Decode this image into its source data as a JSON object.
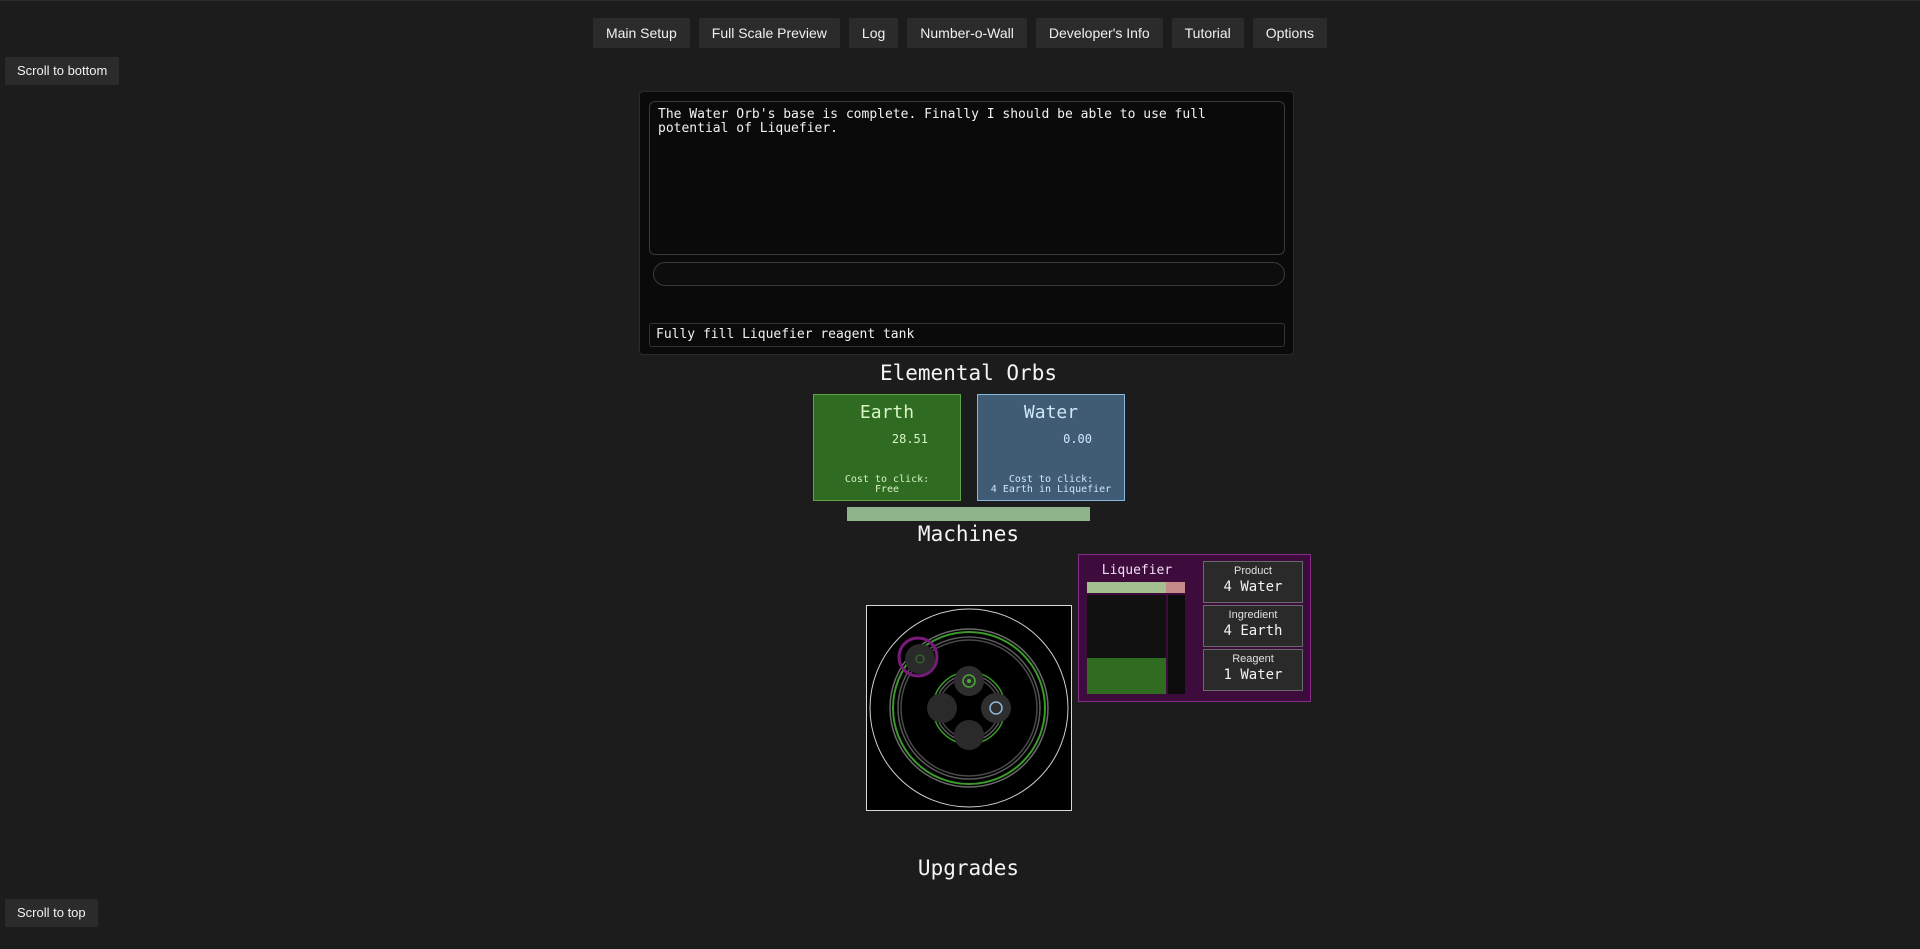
{
  "nav": {
    "items": [
      {
        "label": "Main Setup"
      },
      {
        "label": "Full Scale Preview"
      },
      {
        "label": "Log"
      },
      {
        "label": "Number-o-Wall"
      },
      {
        "label": "Developer's Info"
      },
      {
        "label": "Tutorial"
      },
      {
        "label": "Options"
      }
    ]
  },
  "scroll": {
    "bottom_label": "Scroll to bottom",
    "top_label": "Scroll to top"
  },
  "console": {
    "log_text": "The Water Orb's base is complete. Finally I should be able to use full\npotential of Liquefier.",
    "input_value": "",
    "objective": "Fully fill Liquefier reagent tank"
  },
  "sections": {
    "orbs_title": "Elemental Orbs",
    "machines_title": "Machines",
    "upgrades_title": "Upgrades"
  },
  "orbs": [
    {
      "name": "Earth",
      "value": "28.51",
      "cost_label": "Cost to click:",
      "cost": "Free",
      "color": "#2f6b20"
    },
    {
      "name": "Water",
      "value": "0.00",
      "cost_label": "Cost to click:",
      "cost": "4 Earth in Liquefier",
      "color": "#3f5c74"
    }
  ],
  "orb_progress": 1.0,
  "liquefier": {
    "title": "Liquefier",
    "progress": 0.81,
    "tank_level": 0.36,
    "reagent_level": 0.0,
    "stats": [
      {
        "label": "Product",
        "value": "4 Water"
      },
      {
        "label": "Ingredient",
        "value": "4 Earth"
      },
      {
        "label": "Reagent",
        "value": "1 Water"
      }
    ],
    "color": "#3d0c3d"
  }
}
